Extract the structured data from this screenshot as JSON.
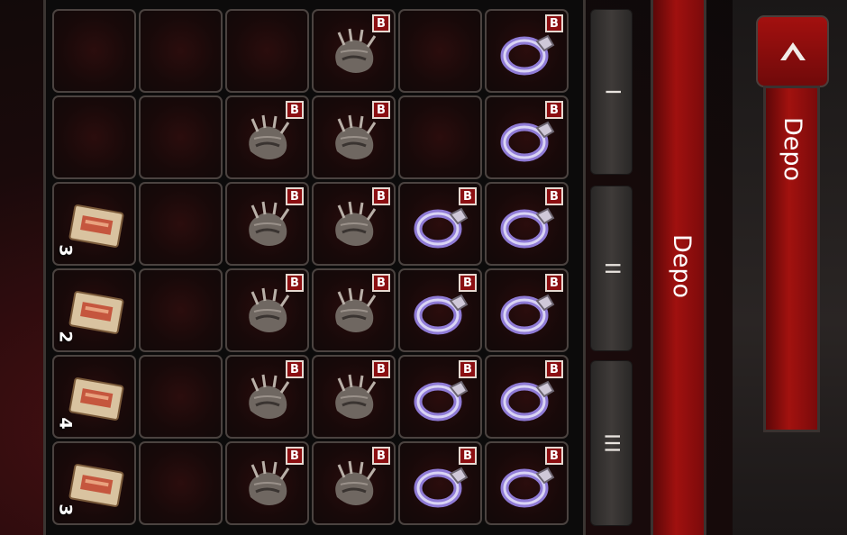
{
  "inventory": {
    "badge_label": "B",
    "rows": [
      [
        {
          "item": "empty"
        },
        {
          "item": "empty"
        },
        {
          "item": "empty"
        },
        {
          "item": "claw",
          "badge": true
        },
        {
          "item": "empty"
        },
        {
          "item": "ring",
          "badge": true
        }
      ],
      [
        {
          "item": "empty"
        },
        {
          "item": "empty"
        },
        {
          "item": "claw",
          "badge": true
        },
        {
          "item": "claw",
          "badge": true
        },
        {
          "item": "empty"
        },
        {
          "item": "ring",
          "badge": true
        }
      ],
      [
        {
          "item": "scroll",
          "count": "3"
        },
        {
          "item": "empty"
        },
        {
          "item": "claw",
          "badge": true
        },
        {
          "item": "claw",
          "badge": true
        },
        {
          "item": "ring",
          "badge": true
        },
        {
          "item": "ring",
          "badge": true
        }
      ],
      [
        {
          "item": "scroll",
          "count": "2"
        },
        {
          "item": "empty"
        },
        {
          "item": "claw",
          "badge": true
        },
        {
          "item": "claw",
          "badge": true
        },
        {
          "item": "ring",
          "badge": true
        },
        {
          "item": "ring",
          "badge": true
        }
      ],
      [
        {
          "item": "scroll",
          "count": "4"
        },
        {
          "item": "empty"
        },
        {
          "item": "claw",
          "badge": true
        },
        {
          "item": "claw",
          "badge": true
        },
        {
          "item": "ring",
          "badge": true
        },
        {
          "item": "ring",
          "badge": true
        }
      ],
      [
        {
          "item": "scroll",
          "count": "3"
        },
        {
          "item": "empty"
        },
        {
          "item": "claw",
          "badge": true
        },
        {
          "item": "claw",
          "badge": true
        },
        {
          "item": "ring",
          "badge": true
        },
        {
          "item": "ring",
          "badge": true
        }
      ]
    ]
  },
  "tabs": [
    {
      "label": "I"
    },
    {
      "label": "II"
    },
    {
      "label": "III"
    }
  ],
  "deposit_bar": {
    "label": "Depo"
  },
  "side_panel": {
    "label": "Depo",
    "collapse_icon": "chevron-up-icon"
  },
  "colors": {
    "accent_red": "#a0110f",
    "slot_border": "#4b4340",
    "badge_red": "#8b0f12"
  }
}
